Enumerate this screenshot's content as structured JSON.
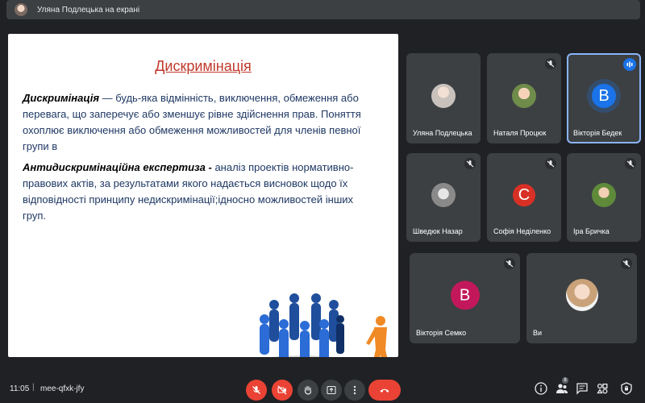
{
  "presenter": {
    "label": "Уляна Подлецька на екрані"
  },
  "slide": {
    "title": "Дискримінація",
    "p1_term": "Дискримінація",
    "p1_text": " — будь-яка відмінність, виключення, обмеження або перевага, що заперечує або зменшує рівне здійснення прав. Поняття охоплює виключення або обмеження можливостей для членів певної групи в",
    "p2_term": "Антидискримінаційна експертиза -",
    "p2_text": " аналіз проектів нормативно-правових актів, за результатами якого надається висновок щодо їх відповідності принципу недискримінації;ідносно можливостей інших груп."
  },
  "participants": [
    {
      "name": "Уляна Подлецька",
      "avatar": "photo",
      "muted": false
    },
    {
      "name": "Наталя Процюк",
      "avatar": "photo",
      "muted": true
    },
    {
      "name": "Вікторія Бедек",
      "avatar": "B",
      "avatar_color": "#1a73e8",
      "muted": false,
      "speaking": true
    },
    {
      "name": "Шведюк Назар",
      "avatar": "photo",
      "muted": true
    },
    {
      "name": "Софія Неділенко",
      "avatar": "C",
      "avatar_color": "#d93025",
      "muted": true
    },
    {
      "name": "Іра Бричка",
      "avatar": "photo",
      "muted": true
    },
    {
      "name": "Вікторія Семко",
      "avatar": "B",
      "avatar_color": "#c2185b",
      "muted": true
    },
    {
      "name": "Ви",
      "avatar": "photo",
      "muted": true
    }
  ],
  "bottombar": {
    "time": "11:05",
    "separator": "|",
    "meeting_code": "mee-qfxk-jfy",
    "controls": [
      "mic-off",
      "camera-off",
      "raise-hand",
      "present",
      "more-options",
      "leave-call"
    ],
    "right_icons": [
      "info",
      "people",
      "chat",
      "activities",
      "host-controls"
    ],
    "people_count": "8"
  },
  "colors": {
    "bg": "#202124",
    "tile": "#3c4043",
    "accent": "#8ab4f8",
    "danger": "#ea4335"
  }
}
